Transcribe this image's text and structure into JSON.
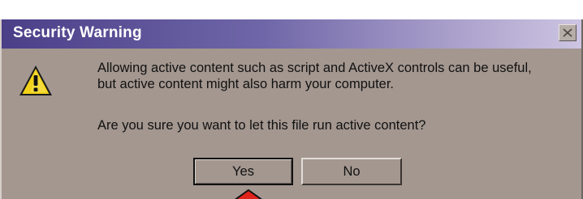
{
  "window": {
    "title": "Security Warning"
  },
  "message": {
    "line1": "Allowing active content such as script and ActiveX controls can be useful,",
    "line2": "but active content might also harm your computer.",
    "question": "Are you sure you want to let this file run active content?"
  },
  "buttons": {
    "yes_label": "Yes",
    "no_label": "No"
  },
  "icons": {
    "warning": "warning-triangle-icon",
    "close": "close-icon",
    "pointer": "pointer-arrow-icon"
  },
  "colors": {
    "dialog_bg": "#a39790",
    "title_start": "#4b3f88",
    "title_end": "#cdc5e2",
    "warning_yellow": "#f2d21a",
    "pointer_red": "#e0241c"
  }
}
